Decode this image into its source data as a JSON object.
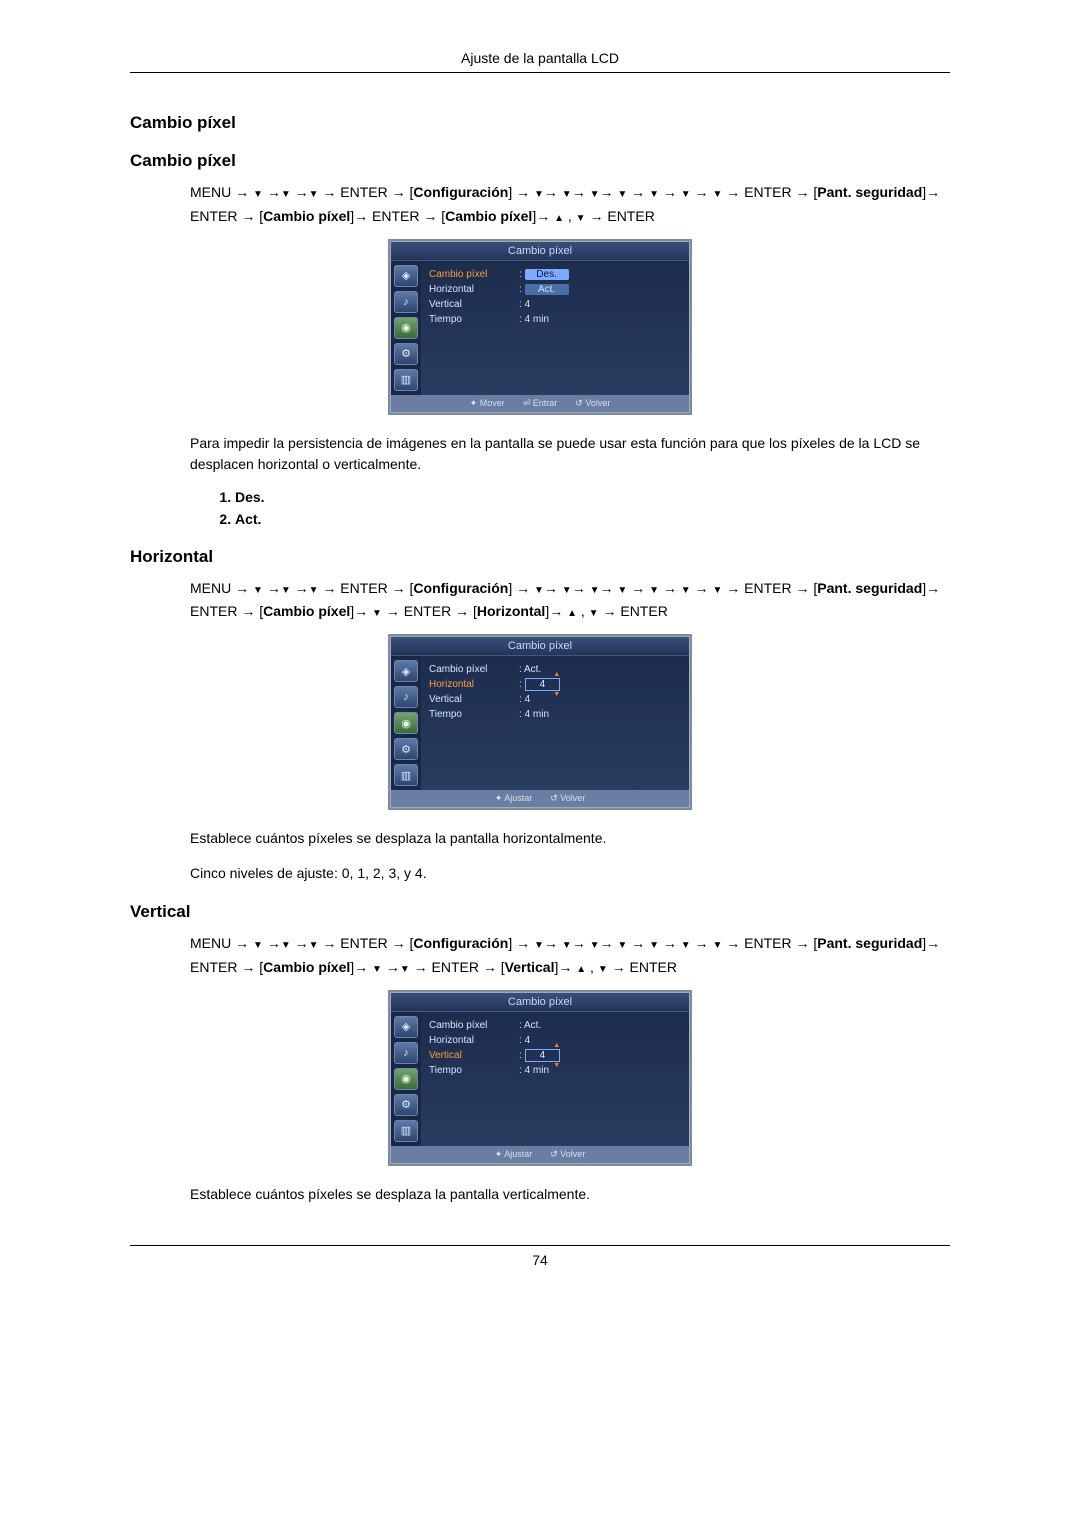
{
  "header": {
    "title": "Ajuste de la pantalla LCD"
  },
  "sections": {
    "cambio1_h": "Cambio píxel",
    "cambio2_h": "Cambio píxel",
    "horizontal_h": "Horizontal",
    "vertical_h": "Vertical"
  },
  "nav": {
    "menu": "MENU",
    "enter": "ENTER",
    "conf": "Configuración",
    "pant": "Pant. seguridad",
    "cpixel": "Cambio píxel",
    "horiz": "Horizontal",
    "vert": "Vertical"
  },
  "osd": {
    "title": "Cambio píxel",
    "labels": {
      "cpixel": "Cambio píxel",
      "horizontal": "Horizontal",
      "vertical": "Vertical",
      "tiempo": "Tiempo"
    },
    "values": {
      "des": "Des.",
      "act": "Act.",
      "four": "4",
      "four_min": "4 min"
    },
    "foot": {
      "mover": "Mover",
      "entrar": "Entrar",
      "volver": "Volver",
      "ajustar": "Ajustar"
    }
  },
  "text": {
    "cambio_desc": "Para impedir la persistencia de imágenes en la pantalla se puede usar esta función para que los píxeles de la LCD se desplacen horizontal o verticalmente.",
    "opt1": "Des.",
    "opt2": "Act.",
    "horiz_desc": "Establece cuántos píxeles se desplaza la pantalla horizontalmente.",
    "levels": "Cinco niveles de ajuste: 0, 1, 2, 3, y 4.",
    "vert_desc": "Establece cuántos píxeles se desplaza la pantalla verticalmente."
  },
  "footer": {
    "page": "74"
  }
}
